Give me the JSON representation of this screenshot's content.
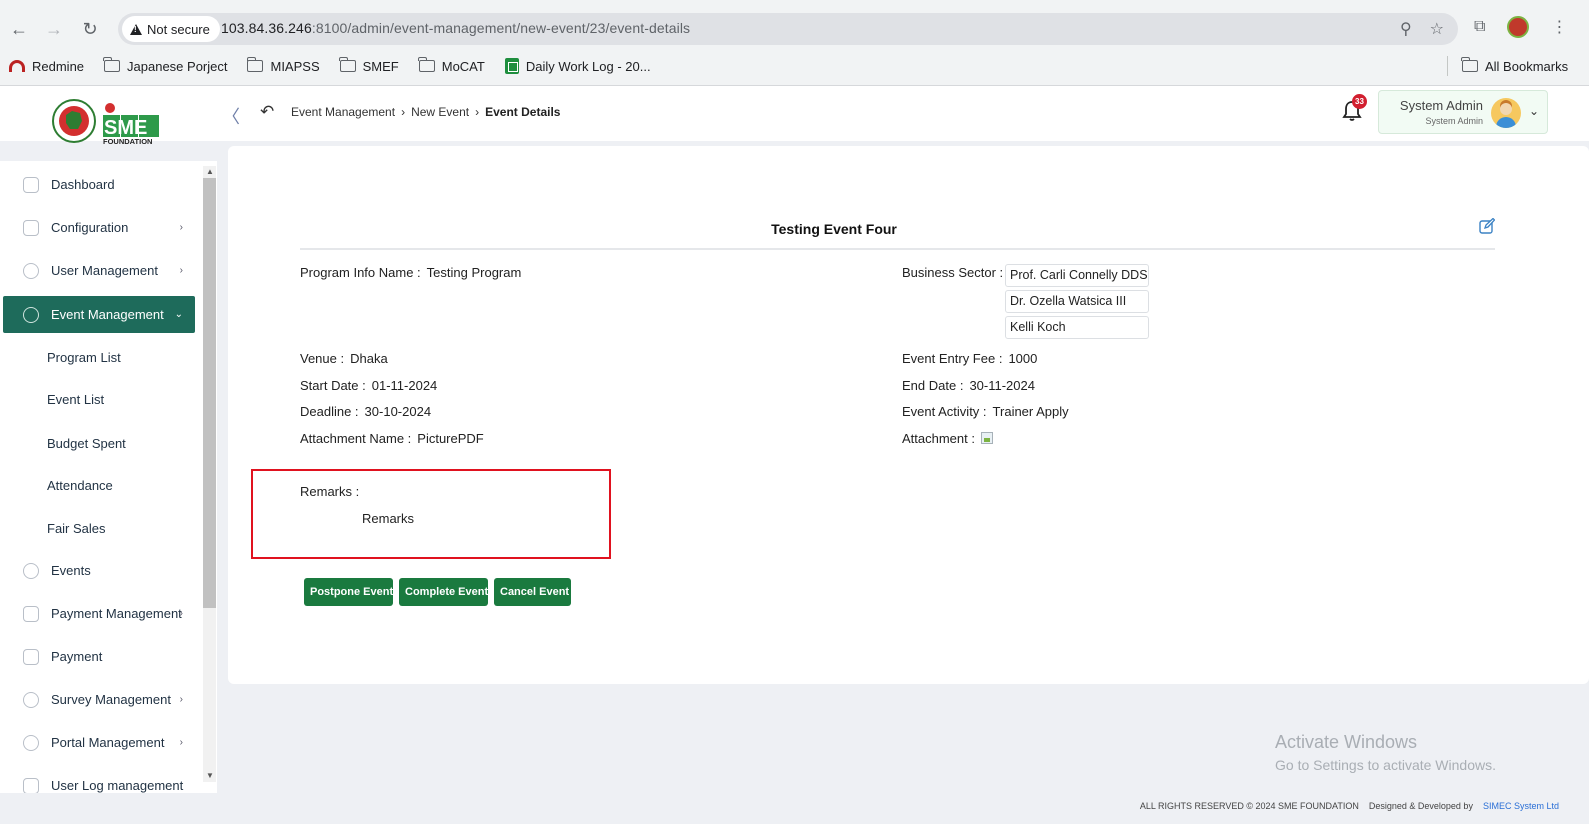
{
  "browser": {
    "security_label": "Not secure",
    "url_host": "103.84.36.246",
    "url_path": ":8100/admin/event-management/new-event/23/event-details",
    "bookmarks": [
      "Redmine",
      "Japanese Porject",
      "MIAPSS",
      "SMEF",
      "MoCAT",
      "Daily Work Log - 20..."
    ],
    "all_bookmarks": "All Bookmarks"
  },
  "header": {
    "logo_text": "SME",
    "logo_sub": "FOUNDATION",
    "breadcrumb": [
      "Event Management",
      "New Event",
      "Event Details"
    ],
    "notification_count": "33",
    "user_name": "System Admin",
    "user_role": "System Admin"
  },
  "sidebar": {
    "items": [
      {
        "label": "Dashboard"
      },
      {
        "label": "Configuration"
      },
      {
        "label": "User Management"
      },
      {
        "label": "Event Management"
      },
      {
        "label": "Events"
      },
      {
        "label": "Payment Management"
      },
      {
        "label": "Payment"
      },
      {
        "label": "Survey Management"
      },
      {
        "label": "Portal Management"
      },
      {
        "label": "User Log management"
      }
    ],
    "sub_items": [
      "Program List",
      "Event List",
      "Budget Spent",
      "Attendance",
      "Fair Sales"
    ]
  },
  "event": {
    "title": "Testing Event Four",
    "program_info_label": "Program Info Name :",
    "program_info_value": "Testing Program",
    "business_sector_label": "Business Sector :",
    "business_sectors": [
      "Prof. Carli Connelly DDS",
      "Dr. Ozella Watsica III",
      "Kelli Koch"
    ],
    "venue_label": "Venue :",
    "venue_value": "Dhaka",
    "entry_fee_label": "Event Entry Fee :",
    "entry_fee_value": "1000",
    "start_date_label": "Start Date :",
    "start_date_value": "01-11-2024",
    "end_date_label": "End Date :",
    "end_date_value": "30-11-2024",
    "deadline_label": "Deadline :",
    "deadline_value": "30-10-2024",
    "activity_label": "Event Activity :",
    "activity_value": "Trainer Apply",
    "attachment_name_label": "Attachment Name :",
    "attachment_name_value": "PicturePDF",
    "attachment_label": "Attachment :",
    "remarks_label": "Remarks :",
    "remarks_value": "Remarks"
  },
  "actions": {
    "postpone": "Postpone Event",
    "complete": "Complete Event",
    "cancel": "Cancel Event"
  },
  "watermark": {
    "line1": "Activate Windows",
    "line2": "Go to Settings to activate Windows."
  },
  "footer": {
    "rights": "ALL RIGHTS RESERVED © 2024 SME FOUNDATION",
    "designed_by": "Designed & Developed by",
    "company": "SIMEC System Ltd"
  },
  "colors": {
    "primary_green": "#1e6b5b",
    "button_green": "#1a7a3f",
    "highlight_red": "#e0121f"
  }
}
